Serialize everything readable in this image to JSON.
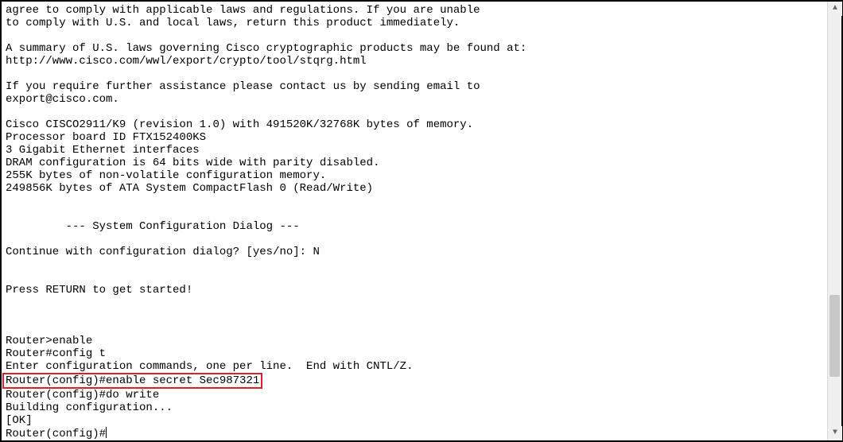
{
  "terminal": {
    "lines": [
      "agree to comply with applicable laws and regulations. If you are unable",
      "to comply with U.S. and local laws, return this product immediately.",
      "",
      "A summary of U.S. laws governing Cisco cryptographic products may be found at:",
      "http://www.cisco.com/wwl/export/crypto/tool/stqrg.html",
      "",
      "If you require further assistance please contact us by sending email to",
      "export@cisco.com.",
      "",
      "Cisco CISCO2911/K9 (revision 1.0) with 491520K/32768K bytes of memory.",
      "Processor board ID FTX152400KS",
      "3 Gigabit Ethernet interfaces",
      "DRAM configuration is 64 bits wide with parity disabled.",
      "255K bytes of non-volatile configuration memory.",
      "249856K bytes of ATA System CompactFlash 0 (Read/Write)",
      "",
      "",
      "         --- System Configuration Dialog ---",
      "",
      "Continue with configuration dialog? [yes/no]: N",
      "",
      "",
      "Press RETURN to get started!",
      "",
      "",
      "",
      "Router>enable",
      "Router#config t",
      "Enter configuration commands, one per line.  End with CNTL/Z."
    ],
    "highlighted_line": "Router(config)#enable secret Sec987321",
    "after_highlight": [
      "Router(config)#do write",
      "Building configuration...",
      "[OK]"
    ],
    "prompt": "Router(config)#"
  },
  "scrollbar": {
    "thumb_top_pct": 68,
    "thumb_height_pct": 20,
    "up_glyph": "▲",
    "down_glyph": "▼"
  }
}
